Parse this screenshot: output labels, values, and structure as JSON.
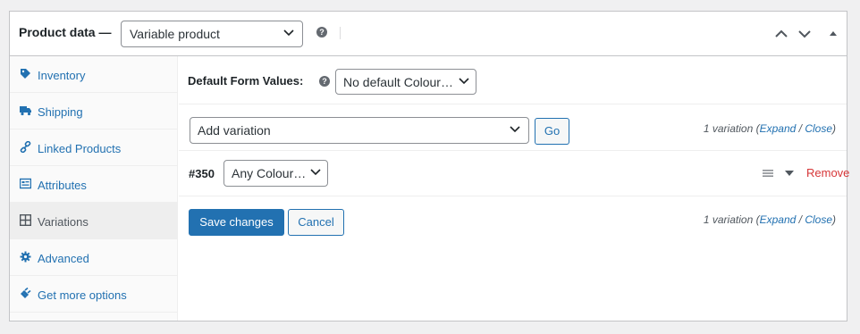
{
  "header": {
    "title": "Product data —",
    "product_type": "Variable product",
    "help_glyph": "?"
  },
  "sidebar": {
    "items": [
      {
        "label": "Inventory",
        "icon": "tag-icon"
      },
      {
        "label": "Shipping",
        "icon": "truck-icon"
      },
      {
        "label": "Linked Products",
        "icon": "link-icon"
      },
      {
        "label": "Attributes",
        "icon": "list-card-icon"
      },
      {
        "label": "Variations",
        "icon": "grid-icon",
        "active": true
      },
      {
        "label": "Advanced",
        "icon": "gear-icon"
      },
      {
        "label": "Get more options",
        "icon": "plugin-icon"
      }
    ]
  },
  "defaults": {
    "label": "Default Form Values:",
    "select_value": "No default Colour…",
    "help_glyph": "?"
  },
  "add_variation": {
    "select_value": "Add variation",
    "go_label": "Go"
  },
  "summary": {
    "count_text": "1 variation",
    "open_paren": "(",
    "expand": "Expand",
    "slash": " / ",
    "close": "Close",
    "close_paren": ")"
  },
  "variation": {
    "id": "#350",
    "attribute_value": "Any Colour…",
    "remove_label": "Remove"
  },
  "actions": {
    "save_label": "Save changes",
    "cancel_label": "Cancel"
  },
  "colors": {
    "accent": "#2271b1",
    "remove": "#d63638",
    "text": "#1d2327"
  }
}
